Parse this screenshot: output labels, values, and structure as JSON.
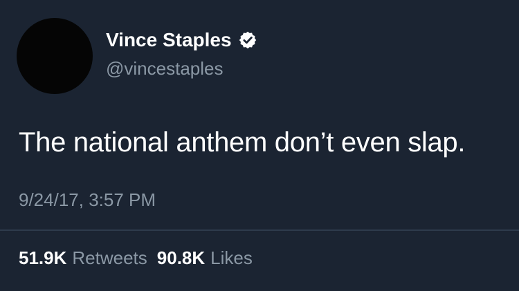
{
  "user": {
    "display_name": "Vince Staples",
    "handle": "@vincestaples",
    "verified_icon": "verified-badge-icon"
  },
  "tweet": {
    "text": "The national anthem don’t even slap.",
    "timestamp": "9/24/17, 3:57 PM"
  },
  "stats": {
    "retweets_count": "51.9K",
    "retweets_label": "Retweets",
    "likes_count": "90.8K",
    "likes_label": "Likes"
  },
  "colors": {
    "background": "#1b2432",
    "primary_text": "#ffffff",
    "secondary_text": "#8b98a5",
    "divider": "#2e3b4c",
    "avatar": "#050505"
  }
}
